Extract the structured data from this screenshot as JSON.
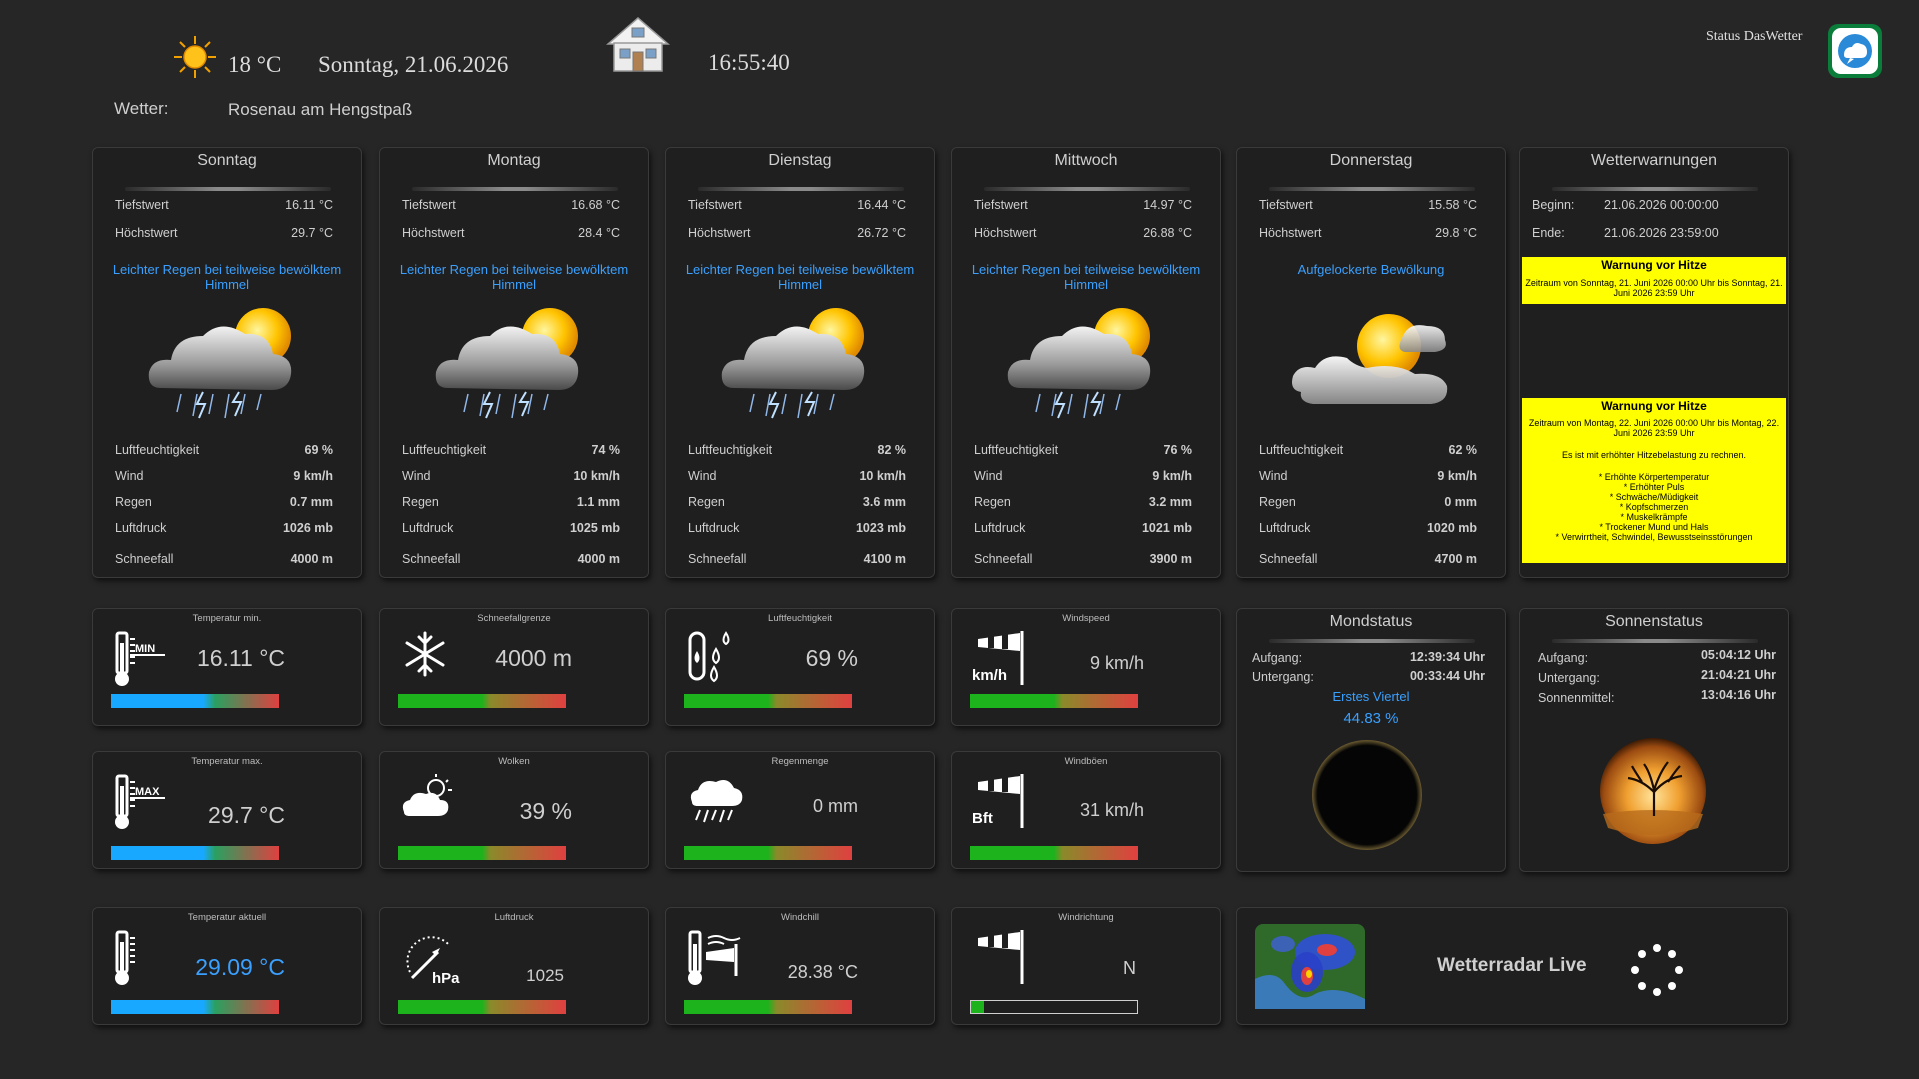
{
  "header": {
    "temperature": "18 °C",
    "date": "Sonntag, 21.06.2026",
    "time": "16:55:40",
    "weather_label": "Wetter:",
    "location": "Rosenau am Hengstpaß",
    "status_label": "Status DasWetter"
  },
  "forecast": [
    {
      "day": "Sonntag",
      "min_label": "Tiefstwert",
      "min": "16.11 °C",
      "max_label": "Höchstwert",
      "max": "29.7 °C",
      "condition": "Leichter Regen bei teilweise bewölktem Himmel",
      "icon": "rain-thunder-sun-icon",
      "humidity_label": "Luftfeuchtigkeit",
      "humidity": "69 %",
      "wind_label": "Wind",
      "wind": "9 km/h",
      "rain_label": "Regen",
      "rain": "0.7 mm",
      "pressure_label": "Luftdruck",
      "pressure": "1026 mb",
      "snow_label": "Schneefall",
      "snow": "4000 m"
    },
    {
      "day": "Montag",
      "min_label": "Tiefstwert",
      "min": "16.68 °C",
      "max_label": "Höchstwert",
      "max": "28.4 °C",
      "condition": "Leichter Regen bei teilweise bewölktem Himmel",
      "icon": "rain-thunder-sun-icon",
      "humidity_label": "Luftfeuchtigkeit",
      "humidity": "74 %",
      "wind_label": "Wind",
      "wind": "10 km/h",
      "rain_label": "Regen",
      "rain": "1.1 mm",
      "pressure_label": "Luftdruck",
      "pressure": "1025 mb",
      "snow_label": "Schneefall",
      "snow": "4000 m"
    },
    {
      "day": "Dienstag",
      "min_label": "Tiefstwert",
      "min": "16.44 °C",
      "max_label": "Höchstwert",
      "max": "26.72 °C",
      "condition": "Leichter Regen bei teilweise bewölktem Himmel",
      "icon": "rain-thunder-sun-icon",
      "humidity_label": "Luftfeuchtigkeit",
      "humidity": "82 %",
      "wind_label": "Wind",
      "wind": "10 km/h",
      "rain_label": "Regen",
      "rain": "3.6 mm",
      "pressure_label": "Luftdruck",
      "pressure": "1023 mb",
      "snow_label": "Schneefall",
      "snow": "4100 m"
    },
    {
      "day": "Mittwoch",
      "min_label": "Tiefstwert",
      "min": "14.97 °C",
      "max_label": "Höchstwert",
      "max": "26.88 °C",
      "condition": "Leichter Regen bei teilweise bewölktem Himmel",
      "icon": "rain-thunder-sun-icon",
      "humidity_label": "Luftfeuchtigkeit",
      "humidity": "76 %",
      "wind_label": "Wind",
      "wind": "9 km/h",
      "rain_label": "Regen",
      "rain": "3.2 mm",
      "pressure_label": "Luftdruck",
      "pressure": "1021 mb",
      "snow_label": "Schneefall",
      "snow": "3900 m"
    },
    {
      "day": "Donnerstag",
      "min_label": "Tiefstwert",
      "min": "15.58 °C",
      "max_label": "Höchstwert",
      "max": "29.8 °C",
      "condition": "Aufgelockerte Bewölkung",
      "icon": "sun-cloud-icon",
      "humidity_label": "Luftfeuchtigkeit",
      "humidity": "62 %",
      "wind_label": "Wind",
      "wind": "9 km/h",
      "rain_label": "Regen",
      "rain": "0 mm",
      "pressure_label": "Luftdruck",
      "pressure": "1020 mb",
      "snow_label": "Schneefall",
      "snow": "4700 m"
    }
  ],
  "warnings": {
    "title": "Wetterwarnungen",
    "begin_label": "Beginn:",
    "begin": "21.06.2026 00:00:00",
    "end_label": "Ende:",
    "end": "21.06.2026 23:59:00",
    "items": [
      {
        "title": "Warnung vor Hitze",
        "text": "Zeitraum von Sonntag, 21. Juni 2026 00:00 Uhr bis Sonntag, 21. Juni 2026 23:59 Uhr"
      },
      {
        "title": "Warnung vor Hitze",
        "text": "Zeitraum von Montag, 22. Juni 2026 00:00 Uhr bis Montag, 22. Juni 2026 23:59 Uhr",
        "detail": "Es ist mit erhöhter Hitzebelastung zu rechnen.",
        "list": [
          "* Erhöhte Körpertemperatur",
          "* Erhöhter Puls",
          "* Schwäche/Müdigkeit",
          "* Kopfschmerzen",
          "* Muskelkrämpfe",
          "* Trockener Mund und Hals",
          "* Verwirrtheit, Schwindel, Bewusstseinsstörungen"
        ]
      }
    ]
  },
  "tiles": {
    "temp_min": {
      "label": "Temperatur min.",
      "value": "16.11 °C",
      "badge": "MIN",
      "level": 0.55
    },
    "snow_line": {
      "label": "Schneefallgrenze",
      "value": "4000 m",
      "level": 1.0
    },
    "humidity": {
      "label": "Luftfeuchtigkeit",
      "value": "69 %",
      "level": 0.69
    },
    "windspeed": {
      "label": "Windspeed",
      "value": "9 km/h",
      "unit_badge": "km/h",
      "level": 0.49
    },
    "temp_max": {
      "label": "Temperatur max.",
      "value": "29.7 °C",
      "badge": "MAX",
      "level": 0.83
    },
    "clouds": {
      "label": "Wolken",
      "value": "39 %",
      "level": 0.49
    },
    "rain_amount": {
      "label": "Regenmenge",
      "value": "0 mm",
      "level": 0.5
    },
    "gusts": {
      "label": "Windböen",
      "value": "31 km/h",
      "unit_badge": "Bft",
      "level": 0.49
    },
    "temp_now": {
      "label": "Temperatur aktuell",
      "value": "29.09 °C",
      "level": 0.85
    },
    "pressure": {
      "label": "Luftdruck",
      "value": "1025",
      "unit_badge": "hPa",
      "level": 1.0
    },
    "windchill": {
      "label": "Windchill",
      "value": "28.38 °C",
      "level": 0.82
    },
    "wind_dir": {
      "label": "Windrichtung",
      "value": "N",
      "level": 0.08
    }
  },
  "moon": {
    "title": "Mondstatus",
    "rise_label": "Aufgang:",
    "rise": "12:39:34 Uhr",
    "set_label": "Untergang:",
    "set": "00:33:44 Uhr",
    "phase": "Erstes Viertel",
    "illumination": "44.83 %"
  },
  "sun": {
    "title": "Sonnenstatus",
    "rise_label": "Aufgang:",
    "rise": "05:04:12 Uhr",
    "set_label": "Untergang:",
    "set": "21:04:21 Uhr",
    "noon_label": "Sonnenmittel:",
    "noon": "13:04:16 Uhr"
  },
  "radar": {
    "label": "Wetterradar Live"
  },
  "colors": {
    "accent": "#3aa0ff",
    "warning_bg": "#ffff00",
    "bar_green": "#1db31d",
    "bar_red": "#e04040",
    "bar_blue": "#19a8ff"
  }
}
